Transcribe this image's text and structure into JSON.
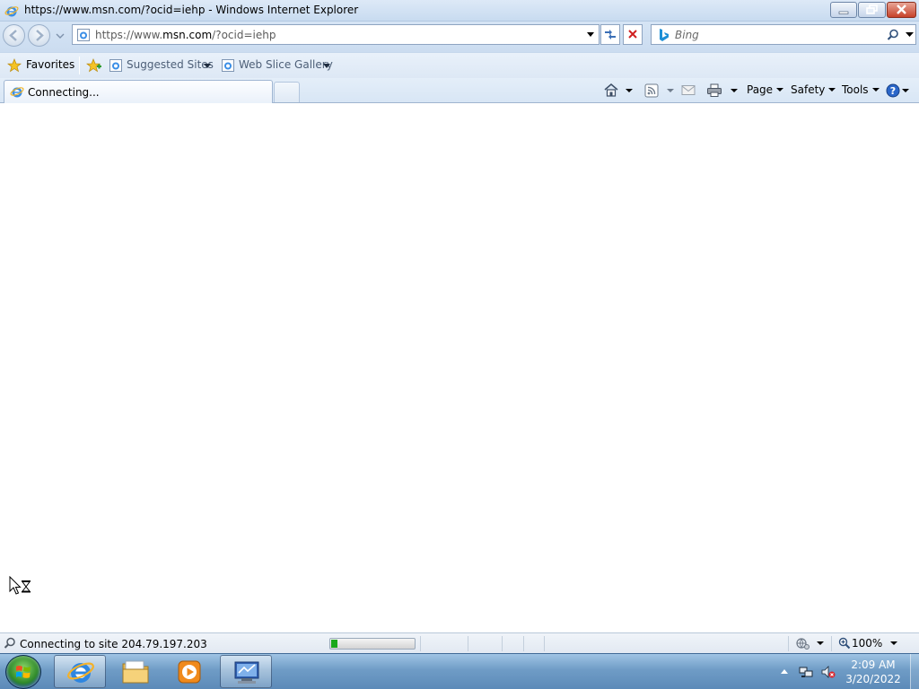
{
  "window": {
    "title": "https://www.msn.com/?ocid=iehp - Windows Internet Explorer"
  },
  "address_bar": {
    "url_prefix": "https://www.",
    "url_domain": "msn.com",
    "url_suffix": "/?ocid=iehp"
  },
  "search": {
    "placeholder": "Bing"
  },
  "favorites_bar": {
    "favorites_label": "Favorites",
    "items": [
      {
        "label": "Suggested Sites"
      },
      {
        "label": "Web Slice Gallery"
      }
    ]
  },
  "tab": {
    "label": "Connecting..."
  },
  "command_bar": {
    "page_label": "Page",
    "safety_label": "Safety",
    "tools_label": "Tools"
  },
  "status_bar": {
    "text": "Connecting to site 204.79.197.203",
    "progress_fraction": 0.08,
    "zoom": "100%"
  },
  "taskbar": {
    "time": "2:09 AM",
    "date": "3/20/2022",
    "apps": [
      {
        "icon": "internet-explorer-icon",
        "active": true
      },
      {
        "icon": "file-explorer-icon",
        "active": false
      },
      {
        "icon": "media-player-icon",
        "active": false
      },
      {
        "icon": "network-monitor-icon",
        "active": true
      }
    ]
  },
  "colors": {
    "progress_fill": "#1aa81a",
    "close_button": "#c7422a",
    "help_icon": "#2a66c9",
    "stop_icon": "#d02020"
  }
}
